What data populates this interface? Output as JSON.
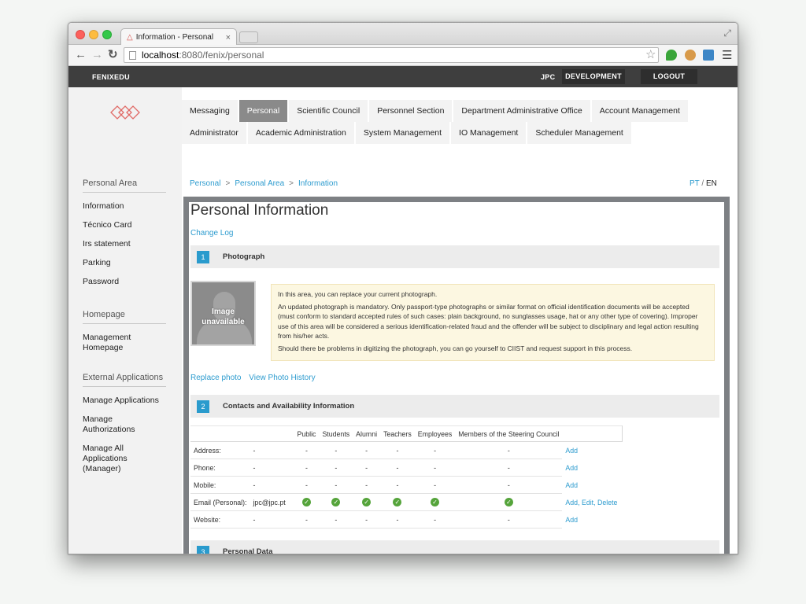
{
  "browser": {
    "tab_title": "Information - Personal",
    "url_host": "localhost",
    "url_path": ":8080/fenix/personal"
  },
  "topbar": {
    "brand": "FENIXEDU",
    "user": "JPC",
    "dev_label": "DEVELOPMENT",
    "logout_label": "LOGOUT"
  },
  "sidebar": {
    "sections": [
      {
        "heading": "Personal Area",
        "items": [
          "Information",
          "Técnico Card",
          "Irs statement",
          "Parking",
          "Password"
        ]
      },
      {
        "heading": "Homepage",
        "items": [
          "Management Homepage"
        ]
      },
      {
        "heading": "External Applications",
        "items": [
          "Manage Applications",
          "Manage Authorizations",
          "Manage All Applications (Manager)"
        ]
      }
    ]
  },
  "menu": {
    "row1": [
      "Messaging",
      "Personal",
      "Scientific Council",
      "Personnel Section",
      "Department Administrative Office",
      "Account Management"
    ],
    "row2": [
      "Administrator",
      "Academic Administration",
      "System Management",
      "IO Management",
      "Scheduler Management"
    ],
    "active": "Personal"
  },
  "breadcrumb": [
    "Personal",
    "Personal Area",
    "Information"
  ],
  "lang": {
    "pt": "PT",
    "sep": "/",
    "en": "EN"
  },
  "page": {
    "title": "Personal Information",
    "change_log": "Change Log"
  },
  "sections": [
    {
      "num": "1",
      "title": "Photograph"
    },
    {
      "num": "2",
      "title": "Contacts and Availability Information"
    },
    {
      "num": "3",
      "title": "Personal Data"
    }
  ],
  "photo": {
    "placeholder_line1": "Image",
    "placeholder_line2": "unavailable",
    "notice": [
      "In this area, you can replace your current photograph.",
      "An updated photograph is mandatory. Only passport-type photographs or similar format on official identification documents will be accepted (must conform to standard accepted rules of such cases: plain background, no sunglasses usage, hat or any other type of covering). Improper use of this area will be considered a serious identification-related fraud and the offender will be subject to disciplinary and legal action resulting from his/her acts.",
      "Should there be problems in digitizing the photograph, you can go yourself to CIIST and request support in this process."
    ],
    "replace_link": "Replace photo",
    "history_link": "View Photo History"
  },
  "contacts": {
    "columns": [
      "Public",
      "Students",
      "Alumni",
      "Teachers",
      "Employees",
      "Members of the Steering Council"
    ],
    "rows": [
      {
        "label": "Address:",
        "value": "-",
        "cells": [
          "-",
          "-",
          "-",
          "-",
          "-",
          "-"
        ],
        "actions": [
          "Add"
        ]
      },
      {
        "label": "Phone:",
        "value": "-",
        "cells": [
          "-",
          "-",
          "-",
          "-",
          "-",
          "-"
        ],
        "actions": [
          "Add"
        ]
      },
      {
        "label": "Mobile:",
        "value": "-",
        "cells": [
          "-",
          "-",
          "-",
          "-",
          "-",
          "-"
        ],
        "actions": [
          "Add"
        ]
      },
      {
        "label": "Email (Personal):",
        "value": "jpc@jpc.pt",
        "cells": [
          "check",
          "check",
          "check",
          "check",
          "check",
          "check"
        ],
        "actions": [
          "Add",
          "Edit",
          "Delete"
        ]
      },
      {
        "label": "Website:",
        "value": "-",
        "cells": [
          "-",
          "-",
          "-",
          "-",
          "-",
          "-"
        ],
        "actions": [
          "Add"
        ]
      }
    ]
  },
  "colors": {
    "accent": "#2e9ccf",
    "topbar": "#3e3e3e",
    "active_tab": "#8a8a8a",
    "notice_bg": "#fcf7e1",
    "check": "#55a43b"
  },
  "icons": {
    "back": "back-arrow-icon",
    "forward": "forward-arrow-icon",
    "reload": "reload-icon",
    "bookmark": "star-icon",
    "menu": "hamburger-menu-icon",
    "check": "check-circle-icon"
  }
}
